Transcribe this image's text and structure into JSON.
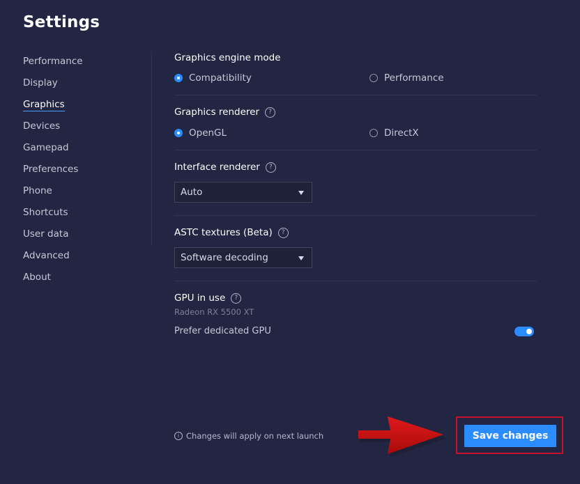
{
  "header": {
    "title": "Settings"
  },
  "sidebar": {
    "items": [
      {
        "label": "Performance"
      },
      {
        "label": "Display"
      },
      {
        "label": "Graphics"
      },
      {
        "label": "Devices"
      },
      {
        "label": "Gamepad"
      },
      {
        "label": "Preferences"
      },
      {
        "label": "Phone"
      },
      {
        "label": "Shortcuts"
      },
      {
        "label": "User data"
      },
      {
        "label": "Advanced"
      },
      {
        "label": "About"
      }
    ],
    "active": "Graphics"
  },
  "graphics": {
    "engine_mode": {
      "label": "Graphics engine mode",
      "options": [
        "Compatibility",
        "Performance"
      ],
      "selected": "Compatibility"
    },
    "renderer": {
      "label": "Graphics renderer",
      "options": [
        "OpenGL",
        "DirectX"
      ],
      "selected": "OpenGL"
    },
    "interface_renderer": {
      "label": "Interface renderer",
      "value": "Auto"
    },
    "astc": {
      "label": "ASTC textures (Beta)",
      "value": "Software decoding"
    },
    "gpu": {
      "label": "GPU in use",
      "name": "Radeon RX 5500 XT",
      "prefer_label": "Prefer dedicated GPU",
      "prefer_enabled": true
    }
  },
  "footer": {
    "note": "Changes will apply on next launch",
    "save_label": "Save changes"
  },
  "colors": {
    "background": "#232642",
    "accent": "#2a8cff",
    "highlight": "#c8102e"
  }
}
